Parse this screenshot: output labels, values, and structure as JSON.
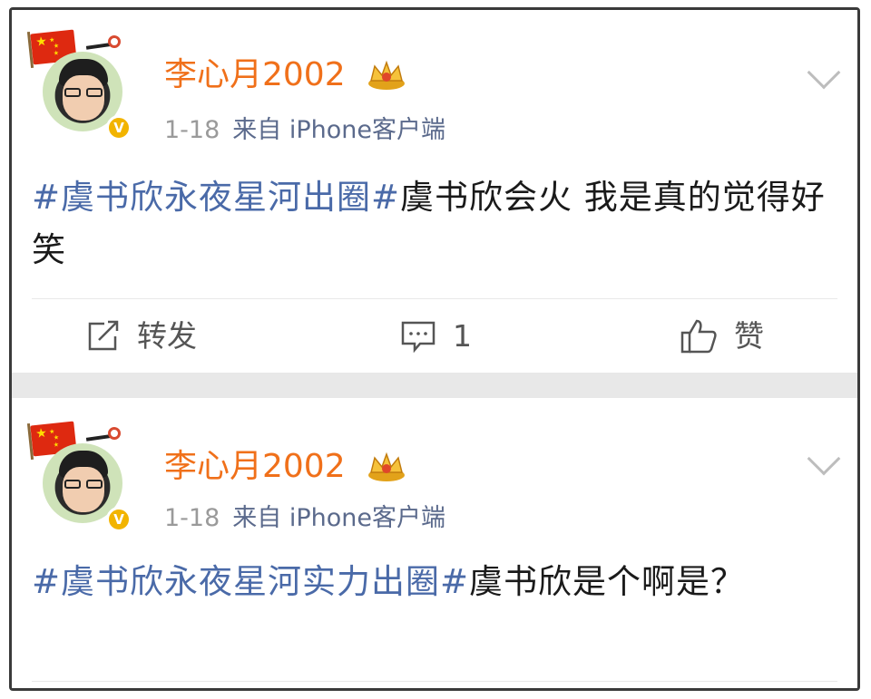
{
  "posts": [
    {
      "username": "李心月2002",
      "time": "1-18",
      "source": "来自 iPhone客户端",
      "tag": "#虞书欣永夜星河出圈#",
      "text": "虞书欣会火 我是真的觉得好笑",
      "actions": {
        "repost": "转发",
        "comment_count": "1",
        "like": "赞"
      }
    },
    {
      "username": "李心月2002",
      "time": "1-18",
      "source": "来自 iPhone客户端",
      "tag": "#虞书欣永夜星河实力出圈#",
      "text": "虞书欣是个啊是？"
    }
  ],
  "colors": {
    "username": "#f0701a",
    "tag": "#4a6aa8",
    "verified": "#f2b400"
  },
  "icons": [
    "china-flag-icon",
    "verified-v-icon",
    "crown-badge-icon",
    "chevron-down-icon",
    "repost-icon",
    "comment-icon",
    "like-icon"
  ]
}
